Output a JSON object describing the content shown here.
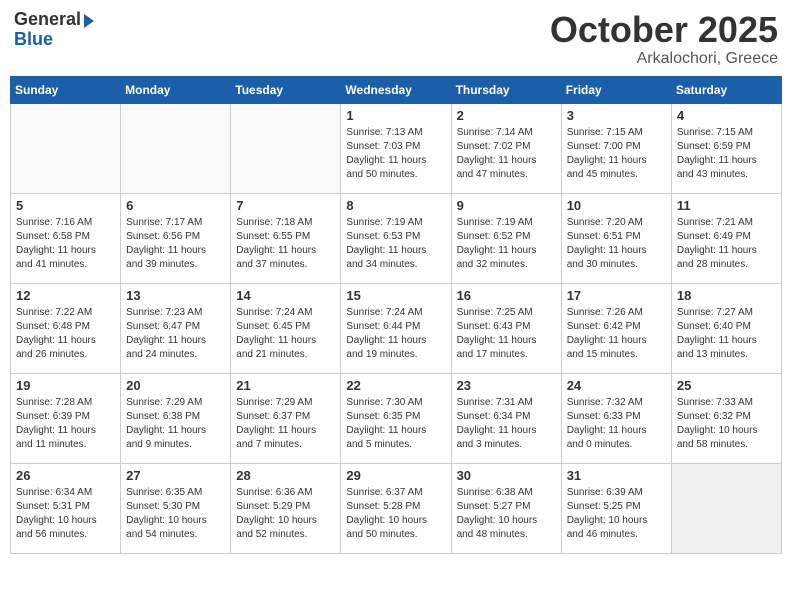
{
  "logo": {
    "line1": "General",
    "line2": "Blue"
  },
  "title": "October 2025",
  "location": "Arkalochori, Greece",
  "days_of_week": [
    "Sunday",
    "Monday",
    "Tuesday",
    "Wednesday",
    "Thursday",
    "Friday",
    "Saturday"
  ],
  "weeks": [
    [
      {
        "day": "",
        "info": ""
      },
      {
        "day": "",
        "info": ""
      },
      {
        "day": "",
        "info": ""
      },
      {
        "day": "1",
        "info": "Sunrise: 7:13 AM\nSunset: 7:03 PM\nDaylight: 11 hours\nand 50 minutes."
      },
      {
        "day": "2",
        "info": "Sunrise: 7:14 AM\nSunset: 7:02 PM\nDaylight: 11 hours\nand 47 minutes."
      },
      {
        "day": "3",
        "info": "Sunrise: 7:15 AM\nSunset: 7:00 PM\nDaylight: 11 hours\nand 45 minutes."
      },
      {
        "day": "4",
        "info": "Sunrise: 7:15 AM\nSunset: 6:59 PM\nDaylight: 11 hours\nand 43 minutes."
      }
    ],
    [
      {
        "day": "5",
        "info": "Sunrise: 7:16 AM\nSunset: 6:58 PM\nDaylight: 11 hours\nand 41 minutes."
      },
      {
        "day": "6",
        "info": "Sunrise: 7:17 AM\nSunset: 6:56 PM\nDaylight: 11 hours\nand 39 minutes."
      },
      {
        "day": "7",
        "info": "Sunrise: 7:18 AM\nSunset: 6:55 PM\nDaylight: 11 hours\nand 37 minutes."
      },
      {
        "day": "8",
        "info": "Sunrise: 7:19 AM\nSunset: 6:53 PM\nDaylight: 11 hours\nand 34 minutes."
      },
      {
        "day": "9",
        "info": "Sunrise: 7:19 AM\nSunset: 6:52 PM\nDaylight: 11 hours\nand 32 minutes."
      },
      {
        "day": "10",
        "info": "Sunrise: 7:20 AM\nSunset: 6:51 PM\nDaylight: 11 hours\nand 30 minutes."
      },
      {
        "day": "11",
        "info": "Sunrise: 7:21 AM\nSunset: 6:49 PM\nDaylight: 11 hours\nand 28 minutes."
      }
    ],
    [
      {
        "day": "12",
        "info": "Sunrise: 7:22 AM\nSunset: 6:48 PM\nDaylight: 11 hours\nand 26 minutes."
      },
      {
        "day": "13",
        "info": "Sunrise: 7:23 AM\nSunset: 6:47 PM\nDaylight: 11 hours\nand 24 minutes."
      },
      {
        "day": "14",
        "info": "Sunrise: 7:24 AM\nSunset: 6:45 PM\nDaylight: 11 hours\nand 21 minutes."
      },
      {
        "day": "15",
        "info": "Sunrise: 7:24 AM\nSunset: 6:44 PM\nDaylight: 11 hours\nand 19 minutes."
      },
      {
        "day": "16",
        "info": "Sunrise: 7:25 AM\nSunset: 6:43 PM\nDaylight: 11 hours\nand 17 minutes."
      },
      {
        "day": "17",
        "info": "Sunrise: 7:26 AM\nSunset: 6:42 PM\nDaylight: 11 hours\nand 15 minutes."
      },
      {
        "day": "18",
        "info": "Sunrise: 7:27 AM\nSunset: 6:40 PM\nDaylight: 11 hours\nand 13 minutes."
      }
    ],
    [
      {
        "day": "19",
        "info": "Sunrise: 7:28 AM\nSunset: 6:39 PM\nDaylight: 11 hours\nand 11 minutes."
      },
      {
        "day": "20",
        "info": "Sunrise: 7:29 AM\nSunset: 6:38 PM\nDaylight: 11 hours\nand 9 minutes."
      },
      {
        "day": "21",
        "info": "Sunrise: 7:29 AM\nSunset: 6:37 PM\nDaylight: 11 hours\nand 7 minutes."
      },
      {
        "day": "22",
        "info": "Sunrise: 7:30 AM\nSunset: 6:35 PM\nDaylight: 11 hours\nand 5 minutes."
      },
      {
        "day": "23",
        "info": "Sunrise: 7:31 AM\nSunset: 6:34 PM\nDaylight: 11 hours\nand 3 minutes."
      },
      {
        "day": "24",
        "info": "Sunrise: 7:32 AM\nSunset: 6:33 PM\nDaylight: 11 hours\nand 0 minutes."
      },
      {
        "day": "25",
        "info": "Sunrise: 7:33 AM\nSunset: 6:32 PM\nDaylight: 10 hours\nand 58 minutes."
      }
    ],
    [
      {
        "day": "26",
        "info": "Sunrise: 6:34 AM\nSunset: 5:31 PM\nDaylight: 10 hours\nand 56 minutes."
      },
      {
        "day": "27",
        "info": "Sunrise: 6:35 AM\nSunset: 5:30 PM\nDaylight: 10 hours\nand 54 minutes."
      },
      {
        "day": "28",
        "info": "Sunrise: 6:36 AM\nSunset: 5:29 PM\nDaylight: 10 hours\nand 52 minutes."
      },
      {
        "day": "29",
        "info": "Sunrise: 6:37 AM\nSunset: 5:28 PM\nDaylight: 10 hours\nand 50 minutes."
      },
      {
        "day": "30",
        "info": "Sunrise: 6:38 AM\nSunset: 5:27 PM\nDaylight: 10 hours\nand 48 minutes."
      },
      {
        "day": "31",
        "info": "Sunrise: 6:39 AM\nSunset: 5:25 PM\nDaylight: 10 hours\nand 46 minutes."
      },
      {
        "day": "",
        "info": ""
      }
    ]
  ]
}
